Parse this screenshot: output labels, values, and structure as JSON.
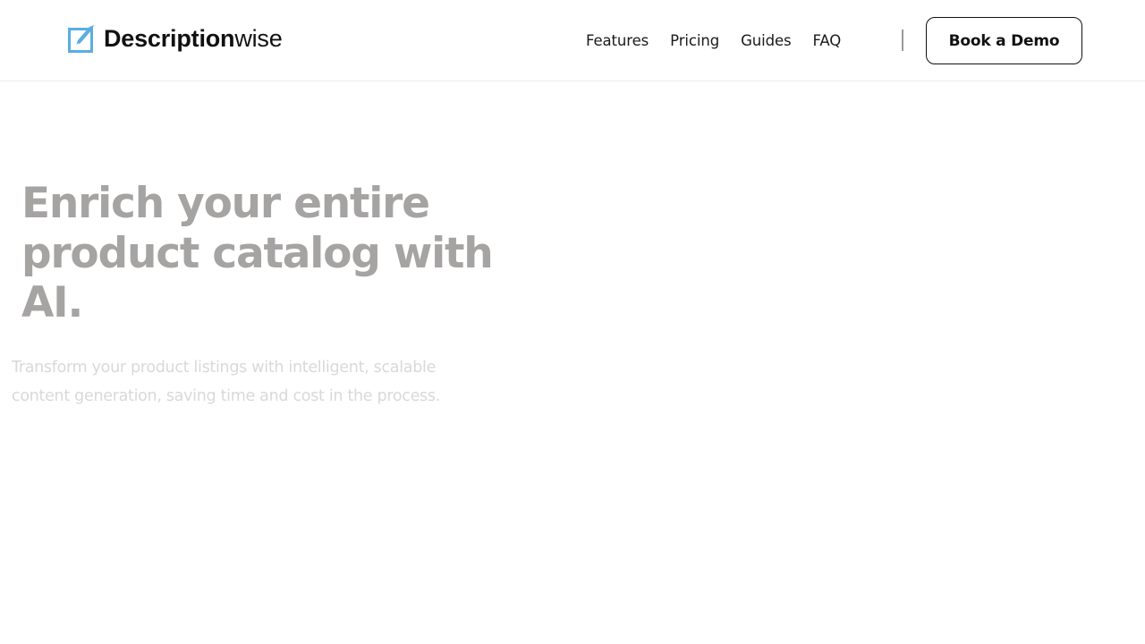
{
  "header": {
    "logo": {
      "brand_bold": "Description",
      "brand_regular": "wise",
      "icon": "pen-square-icon"
    },
    "nav": [
      {
        "label": "Features"
      },
      {
        "label": "Pricing"
      },
      {
        "label": "Guides"
      },
      {
        "label": "FAQ"
      }
    ],
    "cta_label": "Book a Demo"
  },
  "hero": {
    "title": "Enrich your entire product catalog with AI.",
    "subtitle": "Transform your product listings with intelligent, scalable content generation, saving time and cost in the process."
  },
  "colors": {
    "logo_blue": "#5aaee0",
    "title_gray": "#a6a4a3",
    "subtitle_gray": "#d9d9d9",
    "text_dark": "#111111"
  }
}
